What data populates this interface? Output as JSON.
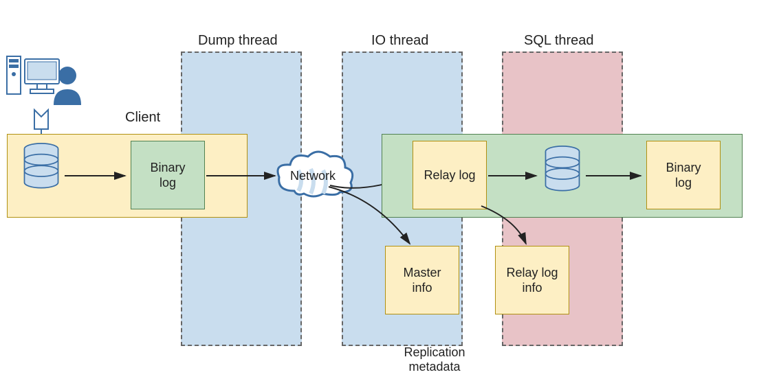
{
  "threads": {
    "dump": "Dump thread",
    "io": "IO thread",
    "sql": "SQL thread"
  },
  "client_label": "Client",
  "nodes": {
    "binlog_master": "Binary\nlog",
    "network": "Network",
    "relay_log": "Relay log",
    "binlog_slave": "Binary\nlog",
    "master_info": "Master\ninfo",
    "relay_log_info": "Relay log\ninfo"
  },
  "meta_label": "Replication\nmetadata"
}
